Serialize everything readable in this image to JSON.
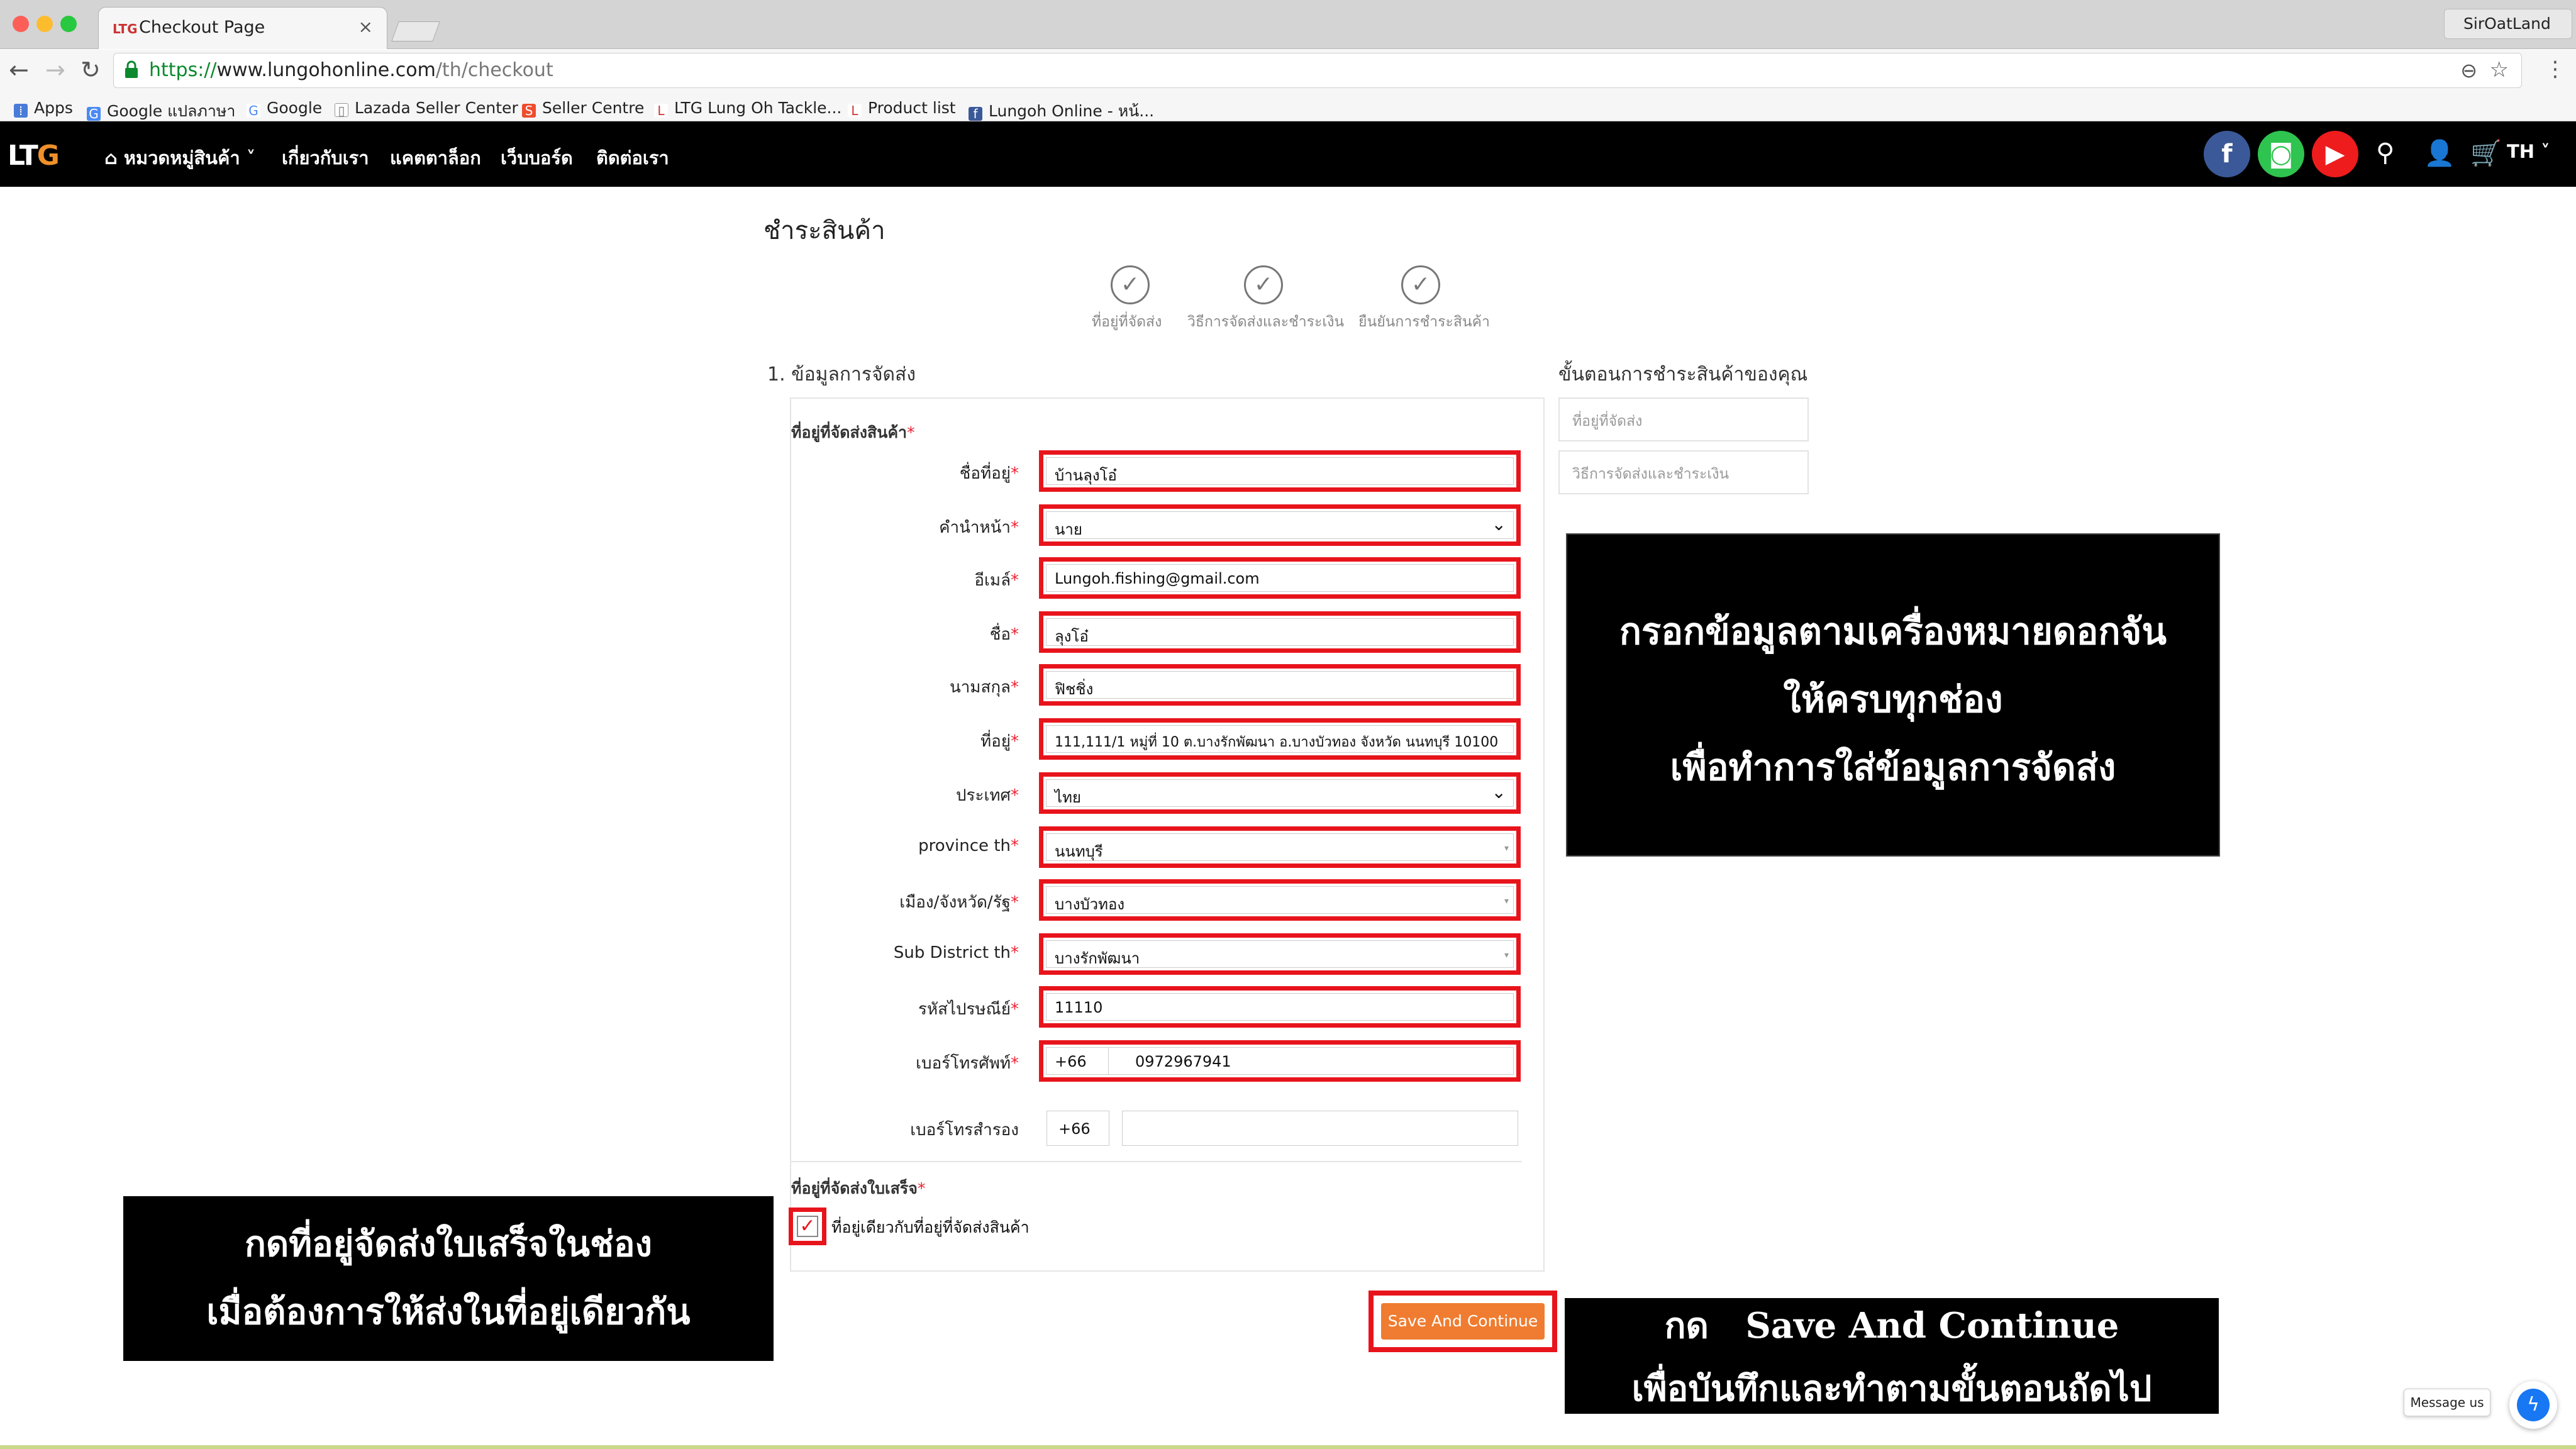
{
  "browser": {
    "tab_title": "Checkout Page",
    "tab_favicon": "LTG",
    "profile_name": "SirOatLand",
    "url_scheme": "https://",
    "url_host": "www.lungohonline.com",
    "url_path": "/th/checkout",
    "bookmarks": [
      "Apps",
      "Google แปลภาษา",
      "Google",
      "Lazada Seller Center",
      "Seller Centre",
      "LTG Lung Oh Tackle...",
      "Product list",
      "Lungoh Online - หน้..."
    ]
  },
  "site": {
    "logo_a": "LT",
    "logo_b": "G",
    "nav": [
      "หมวดหมู่สินค้า",
      "เกี่ยวกับเรา",
      "แคตตาล็อก",
      "เว็บบอร์ด",
      "ติดต่อเรา"
    ],
    "lang": "TH",
    "colors": {
      "facebook": "#3b5998",
      "line": "#2fc34f",
      "youtube": "#ee1c1c",
      "accent": "#ef7c30",
      "highlight": "#e8141c"
    }
  },
  "checkout": {
    "page_title": "ชำระสินค้า",
    "steps": [
      "ที่อยู่ที่จัดส่ง",
      "วิธีการจัดส่งและชำระเงิน",
      "ยืนยันการชำระสินค้า"
    ],
    "section_title": "1. ข้อมูลการจัดส่ง",
    "shipping_header": "ที่อยู่ที่จัดส่งสินค้า",
    "required_mark": "*",
    "fields": [
      {
        "label": "ชื่อที่อยู่",
        "value": "บ้านลุงโอ๋"
      },
      {
        "label": "คำนำหน้า",
        "value": "นาย"
      },
      {
        "label": "อีเมล์",
        "value": "Lungoh.fishing@gmail.com"
      },
      {
        "label": "ชื่อ",
        "value": "ลุงโอ๋"
      },
      {
        "label": "นามสกุล",
        "value": "ฟิชชิ่ง"
      },
      {
        "label": "ที่อยู่",
        "value": "111,111/1 หมู่ที่ 10 ต.บางรักพัฒนา อ.บางบัวทอง จังหวัด นนทบุรี 10100"
      },
      {
        "label": "ประเทศ",
        "value": "ไทย"
      },
      {
        "label": "province th",
        "value": "นนทบุรี"
      },
      {
        "label": "เมือง/จังหวัด/รัฐ",
        "value": "บางบัวทอง"
      },
      {
        "label": "Sub District th",
        "value": "บางรักพัฒนา"
      },
      {
        "label": "รหัสไปรษณีย์",
        "value": "11110"
      },
      {
        "label": "เบอร์โทรศัพท์",
        "country_code": "+66",
        "value": "0972967941"
      }
    ],
    "alt_phone_label": "เบอร์โทรสำรอง",
    "alt_phone_cc": "+66",
    "billing_header": "ที่อยู่ที่จัดส่งใบเสร็จ",
    "billing_same_label": "ที่อยู่เดียวกับที่อยู่ที่จัดส่งสินค้า",
    "billing_same_checked": true,
    "save_label": "Save And Continue",
    "sidebar_title": "ขั้นตอนการชำระสินค้าของคุณ",
    "sidebar_steps": [
      "ที่อยู่ที่จัดส่ง",
      "วิธีการจัดส่งและชำระเงิน"
    ]
  },
  "annotations": {
    "fill": [
      "กรอกข้อมูลตามเครื่องหมายดอกจัน",
      "ให้ครบทุกช่อง",
      "เพื่อทำการใส่ข้อมูลการจัดส่ง"
    ],
    "billing": [
      "กดที่อยู่จัดส่งใบเสร็จในช่อง",
      "เมื่อต้องการให้ส่งในที่อยู่เดียวกัน"
    ],
    "save": [
      "กด   Save And Continue",
      "เพื่อบันทึกและทำตามขั้นตอนถัดไป"
    ]
  },
  "chat": {
    "label": "Message us"
  }
}
